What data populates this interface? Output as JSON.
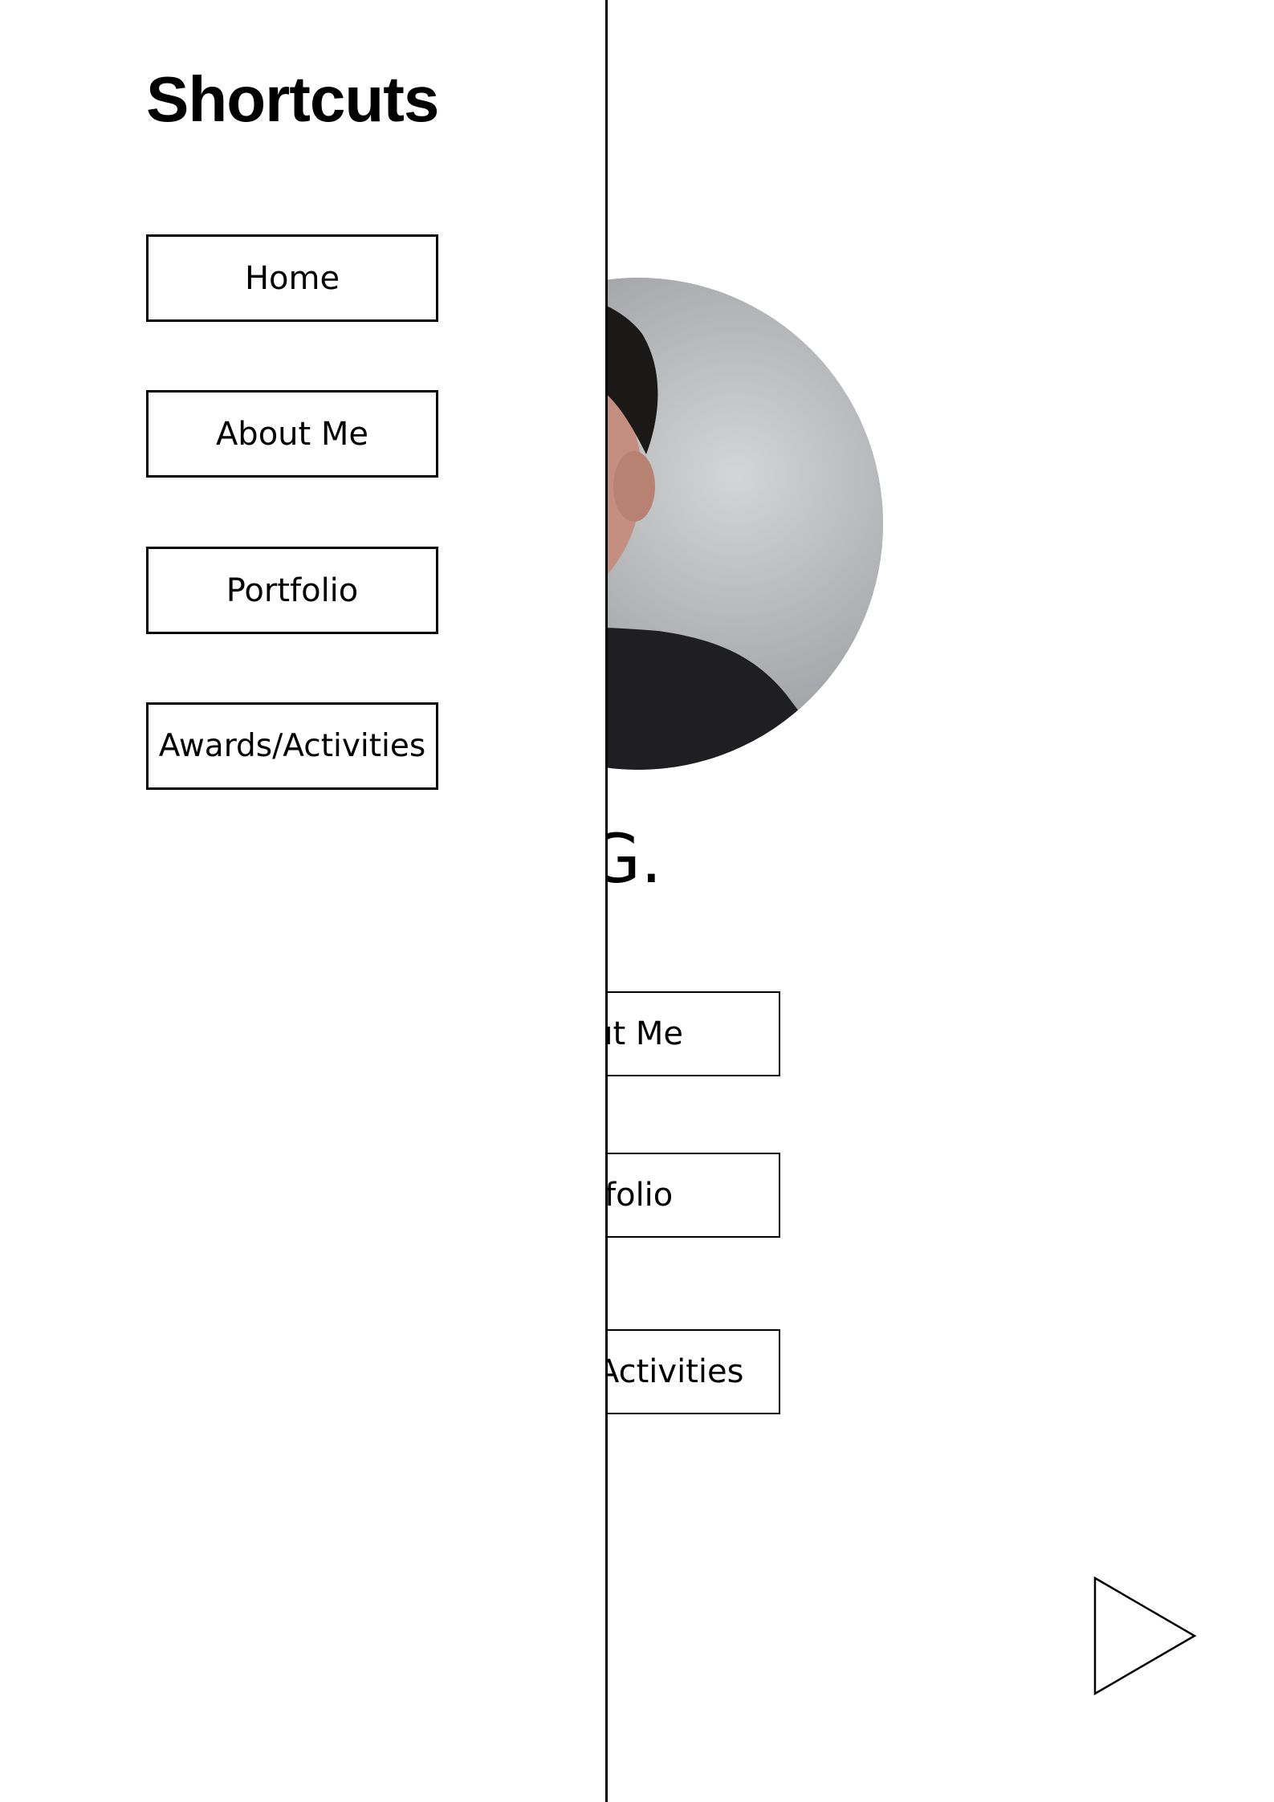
{
  "drawer": {
    "title": "Shortcuts",
    "items": [
      {
        "label": "Home"
      },
      {
        "label": "About Me"
      },
      {
        "label": "Portfolio"
      },
      {
        "label": "Awards/Activities"
      }
    ]
  },
  "main": {
    "name": "el, EJ G.",
    "buttons": [
      {
        "label": "About Me"
      },
      {
        "label": "Portfolio"
      },
      {
        "label": "Awards/Activities"
      }
    ]
  },
  "colors": {
    "background": "#ffffff",
    "foreground": "#000000",
    "avatar_background": "#9ea0a3"
  },
  "icons": {
    "next": "play-triangle-icon"
  }
}
